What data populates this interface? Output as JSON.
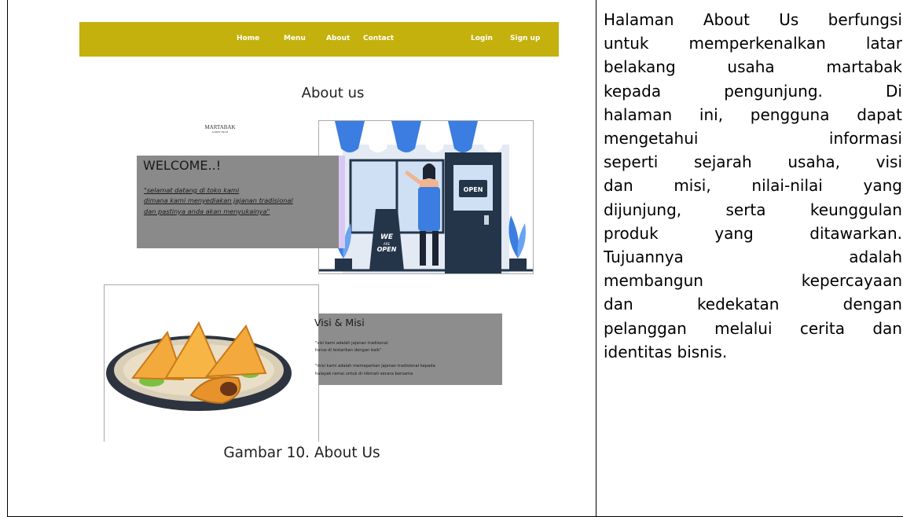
{
  "mock_site": {
    "nav": {
      "home": "Home",
      "menu": "Menu",
      "about": "About",
      "contact": "Contact",
      "login": "Login",
      "signup": "Sign up"
    },
    "colors": {
      "nav_bg": "#c4b10d",
      "overlay": "#8a8a8a",
      "accent_blue": "#3b7de0"
    },
    "page_title": "About us",
    "brand": {
      "name": "MARTABAK",
      "tagline": "LUMER TELUR"
    },
    "welcome": {
      "heading": "WELCOME..!",
      "lines": [
        "\"selamat datang di toko kami",
        "dimana kami menyediakan jajanan tradisional",
        "dan pastinya anda akan menyukainya\""
      ]
    },
    "shop_illustration": {
      "open_sign": "OPEN",
      "stand_sign": [
        "WE",
        "ARE",
        "OPEN"
      ]
    },
    "visi": {
      "heading": "Visi & Misi",
      "lines": [
        "\"visi kami adalah jajanan tradisonal",
        "harus di lestarikan dengan baik\"",
        "\"misi kami adalah memaparkan jajanan tradisional kepada",
        "halayak ramai untuk di nikmati secara bersama"
      ]
    }
  },
  "caption": "Gambar 10. About Us",
  "description_lines": [
    "Halaman About Us berfungsi",
    "untuk memperkenalkan latar",
    "belakang usaha martabak",
    "kepada pengunjung. Di",
    "halaman ini, pengguna dapat",
    "mengetahui informasi",
    "seperti sejarah usaha, visi",
    "dan misi, nilai-nilai yang",
    "dijunjung, serta keunggulan",
    "produk yang ditawarkan.",
    "Tujuannya adalah",
    "membangun kepercayaan",
    "dan kedekatan dengan",
    "pelanggan melalui cerita dan",
    "identitas bisnis."
  ]
}
